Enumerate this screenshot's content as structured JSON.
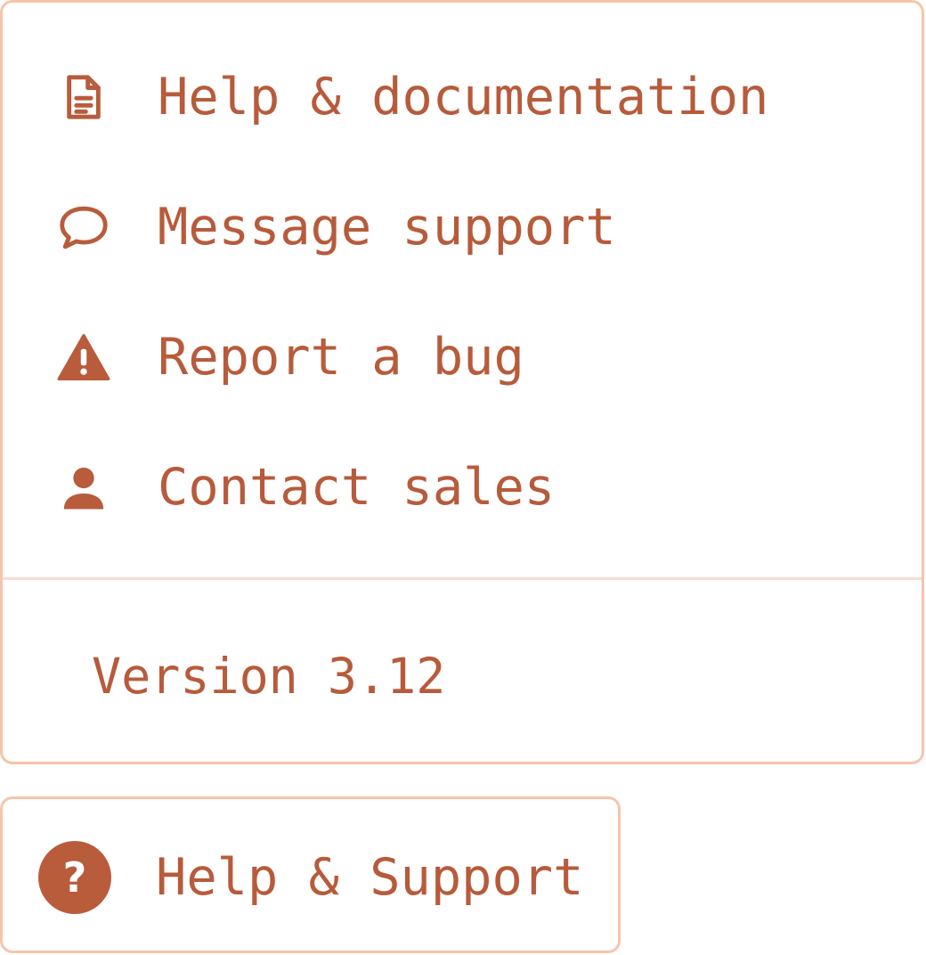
{
  "menu": {
    "items": [
      {
        "label": "Help & documentation",
        "icon": "document-icon"
      },
      {
        "label": "Message support",
        "icon": "chat-bubble-icon"
      },
      {
        "label": "Report a bug",
        "icon": "warning-icon"
      },
      {
        "label": "Contact sales",
        "icon": "person-icon"
      }
    ],
    "version": "Version 3.12"
  },
  "help_button": {
    "label": "Help & Support",
    "icon_glyph": "?",
    "icon": "question-circle-icon"
  },
  "colors": {
    "accent": "#b85c3c",
    "border": "#f6c4ab",
    "divider": "#f6dcd3",
    "background": "#ffffff"
  }
}
